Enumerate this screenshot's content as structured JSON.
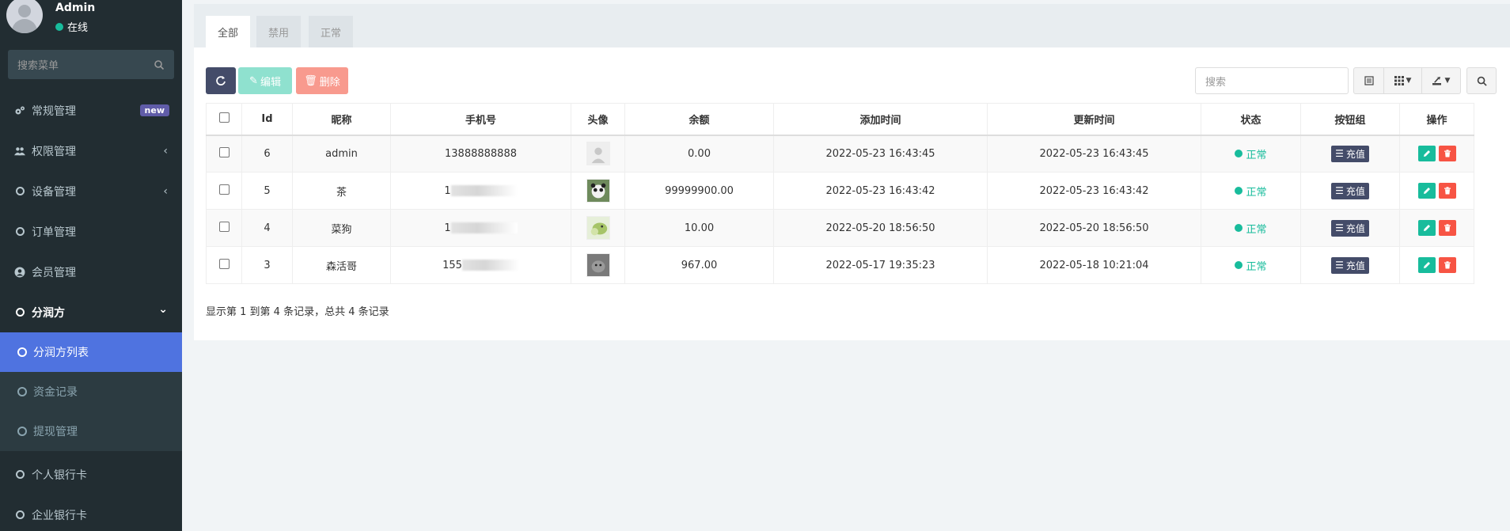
{
  "user": {
    "name": "Admin",
    "status": "在线"
  },
  "sidebar": {
    "search_placeholder": "搜索菜单",
    "items": [
      {
        "label": "常规管理",
        "icon": "cogs-icon",
        "badge": "new"
      },
      {
        "label": "权限管理",
        "icon": "users-icon",
        "arrow": "‹"
      },
      {
        "label": "设备管理",
        "icon": "circle-icon",
        "arrow": "‹"
      },
      {
        "label": "订单管理",
        "icon": "circle-icon"
      },
      {
        "label": "会员管理",
        "icon": "user-circle-icon"
      },
      {
        "label": "分润方",
        "icon": "circle-icon",
        "arrow": "⌄"
      }
    ],
    "sub_items": [
      {
        "label": "分润方列表"
      },
      {
        "label": "资金记录"
      },
      {
        "label": "提现管理"
      }
    ],
    "items_after": [
      {
        "label": "个人银行卡",
        "icon": "circle-icon"
      },
      {
        "label": "企业银行卡",
        "icon": "circle-icon"
      }
    ]
  },
  "tabs": [
    "全部",
    "禁用",
    "正常"
  ],
  "toolbar": {
    "edit_label": "编辑",
    "delete_label": "删除",
    "search_placeholder": "搜索"
  },
  "table": {
    "headers": [
      "Id",
      "昵称",
      "手机号",
      "头像",
      "余额",
      "添加时间",
      "更新时间",
      "状态",
      "按钮组",
      "操作"
    ],
    "rows": [
      {
        "id": "6",
        "nickname": "admin",
        "phone": "13888888888",
        "balance": "0.00",
        "created": "2022-05-23 16:43:45",
        "updated": "2022-05-23 16:43:45",
        "status": "正常",
        "btn": "充值"
      },
      {
        "id": "5",
        "nickname": "茶",
        "phone": "1",
        "balance": "99999900.00",
        "created": "2022-05-23 16:43:42",
        "updated": "2022-05-23 16:43:42",
        "status": "正常",
        "btn": "充值"
      },
      {
        "id": "4",
        "nickname": "菜狗",
        "phone": "1",
        "balance": "10.00",
        "created": "2022-05-20 18:56:50",
        "updated": "2022-05-20 18:56:50",
        "status": "正常",
        "btn": "充值"
      },
      {
        "id": "3",
        "nickname": "森活哥",
        "phone": "155",
        "balance": "967.00",
        "created": "2022-05-17 19:35:23",
        "updated": "2022-05-18 10:21:04",
        "status": "正常",
        "btn": "充值"
      }
    ]
  },
  "pager_info": "显示第 1 到第 4 条记录，总共 4 条记录",
  "colors": {
    "sidebar": "#222d32",
    "active": "#4f73e0",
    "success": "#18bc9c",
    "danger": "#f75444",
    "primary": "#444c69"
  }
}
